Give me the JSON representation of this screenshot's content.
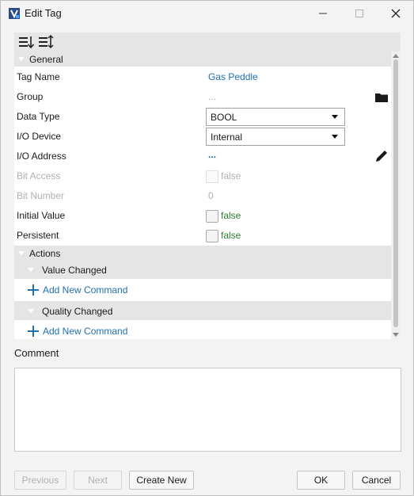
{
  "window": {
    "title": "Edit Tag"
  },
  "categories": {
    "general": "General",
    "actions": "Actions",
    "value_changed": "Value Changed",
    "quality_changed": "Quality Changed"
  },
  "properties": {
    "tag_name": {
      "label": "Tag Name",
      "value": "Gas Peddle"
    },
    "group": {
      "label": "Group",
      "value": "..."
    },
    "data_type": {
      "label": "Data Type",
      "value": "BOOL"
    },
    "io_device": {
      "label": "I/O Device",
      "value": "Internal"
    },
    "io_address": {
      "label": "I/O Address",
      "value": "..."
    },
    "bit_access": {
      "label": "Bit Access",
      "value": "false"
    },
    "bit_number": {
      "label": "Bit Number",
      "value": "0"
    },
    "initial_value": {
      "label": "Initial Value",
      "value": "false"
    },
    "persistent": {
      "label": "Persistent",
      "value": "false"
    }
  },
  "commands": {
    "add_value_changed": "Add New Command",
    "add_quality_changed": "Add New Command"
  },
  "comment": {
    "label": "Comment",
    "value": ""
  },
  "buttons": {
    "previous": "Previous",
    "next": "Next",
    "create_new": "Create New",
    "ok": "OK",
    "cancel": "Cancel"
  },
  "colors": {
    "link_blue": "#1f6fb2",
    "bool_green": "#2e7d32",
    "category_bg": "#e5e5e5",
    "disabled_gray": "#b0b0b0"
  },
  "icons": {
    "app": "edit-tag-app-icon",
    "sort_categorized": "categorized-sort-icon",
    "sort_alpha": "alphabetical-sort-icon",
    "group_browse": "folder-icon",
    "address_edit": "pencil-icon"
  }
}
